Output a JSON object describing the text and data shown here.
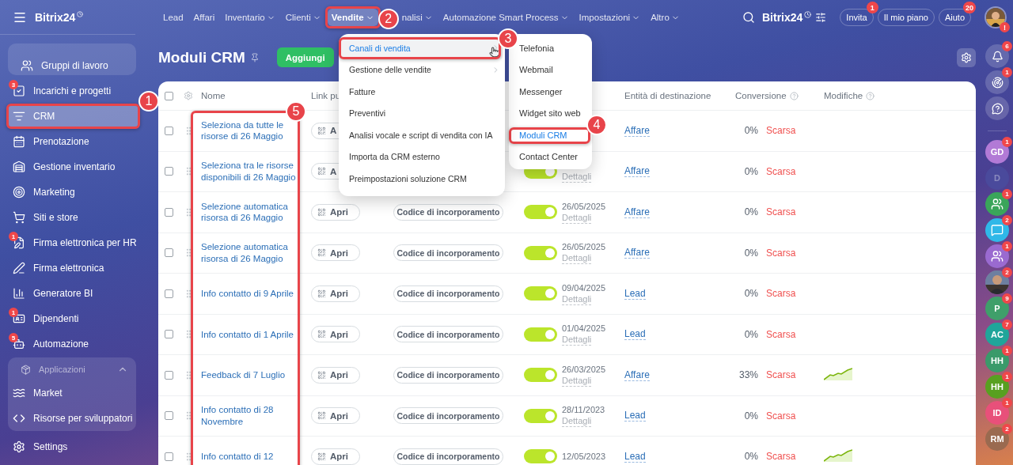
{
  "sidebar": {
    "logo": "Bitrix24",
    "items": [
      {
        "label": "Gruppi di lavoro",
        "selected": false,
        "grouped": true
      },
      {
        "label": "Incarichi e progetti",
        "badge": "3",
        "selected": false
      },
      {
        "label": "CRM",
        "selected": true,
        "callout": "1"
      },
      {
        "label": "Prenotazione",
        "selected": false
      },
      {
        "label": "Gestione inventario",
        "selected": false
      },
      {
        "label": "Marketing",
        "selected": false
      },
      {
        "label": "Siti e store",
        "selected": false
      },
      {
        "label": "Firma elettronica per HR",
        "badge": "1",
        "selected": false
      },
      {
        "label": "Firma elettronica",
        "selected": false
      },
      {
        "label": "Generatore BI",
        "selected": false
      },
      {
        "label": "Dipendenti",
        "badge": "1",
        "selected": false
      },
      {
        "label": "Automazione",
        "badge": "5",
        "selected": false
      }
    ],
    "apps": {
      "title": "Applicazioni",
      "expanded": true,
      "items": [
        {
          "label": "Market",
          "selected": false
        },
        {
          "label": "Risorse per sviluppatori",
          "selected": false
        }
      ]
    },
    "settings": "Settings"
  },
  "topbar": {
    "nav": [
      {
        "label": "Lead",
        "dropdown": false,
        "selected": false
      },
      {
        "label": "Affari",
        "dropdown": false,
        "selected": false
      },
      {
        "label": "Inventario",
        "dropdown": true,
        "selected": false
      },
      {
        "label": "Clienti",
        "dropdown": true,
        "selected": false
      },
      {
        "label": "Vendite",
        "dropdown": true,
        "selected": true,
        "callout": "2"
      },
      {
        "label": "nalisi",
        "dropdown": true,
        "selected": false
      },
      {
        "label": "Automazione Smart Process",
        "dropdown": true,
        "selected": false
      },
      {
        "label": "Impostazioni",
        "dropdown": true,
        "selected": false
      },
      {
        "label": "Altro",
        "dropdown": true,
        "selected": false
      }
    ],
    "brand": "Bitrix24",
    "buttons": [
      {
        "label": "Invita",
        "badge": "1"
      },
      {
        "label": "Il mio piano"
      },
      {
        "label": "Aiuto",
        "badge": "20"
      }
    ],
    "avatar_badge": "!"
  },
  "sales_menu": {
    "items": [
      {
        "label": "Canali di vendita",
        "submenu": true,
        "selected": true,
        "callout": "3"
      },
      {
        "label": "Gestione delle vendite",
        "submenu": true,
        "selected": false
      },
      {
        "label": "Fatture",
        "submenu": false,
        "selected": false
      },
      {
        "label": "Preventivi",
        "submenu": false,
        "selected": false
      },
      {
        "label": "Analisi vocale e script di vendita con IA",
        "submenu": false,
        "selected": false
      },
      {
        "label": "Importa da CRM esterno",
        "submenu": false,
        "selected": false
      },
      {
        "label": "Preimpostazioni soluzione CRM",
        "submenu": false,
        "selected": false
      }
    ]
  },
  "channels_menu": {
    "items": [
      {
        "label": "Telefonia",
        "selected": false
      },
      {
        "label": "Webmail",
        "selected": false
      },
      {
        "label": "Messenger",
        "selected": false
      },
      {
        "label": "Widget sito web",
        "selected": false
      },
      {
        "label": "Moduli CRM",
        "selected": true,
        "callout": "4"
      },
      {
        "label": "Contact Center",
        "selected": false
      }
    ]
  },
  "page": {
    "title": "Moduli CRM",
    "add_button": "Aggiungi"
  },
  "table": {
    "name_callout": "5",
    "all_checked": false,
    "columns": [
      {
        "label": "Nome",
        "help": false
      },
      {
        "label": "Link pu",
        "help": false
      },
      {
        "label": "Entità di destinazione",
        "help": false
      },
      {
        "label": "Conversione",
        "help": true
      },
      {
        "label": "Modifiche",
        "help": true
      }
    ],
    "rows": [
      {
        "checked": false,
        "name": "Seleziona da tutte le risorse di 26 Maggio",
        "link": "A",
        "entity": "Affare",
        "conversion": "0%",
        "rating": "Scarsa",
        "trend": false
      },
      {
        "checked": false,
        "name": "Seleziona tra le risorse disponibili di 26 Maggio",
        "link": "A",
        "active": true,
        "details": "Dettagli",
        "entity": "Affare",
        "conversion": "0%",
        "rating": "Scarsa",
        "trend": false
      },
      {
        "checked": false,
        "name": "Selezione automatica risorsa di 26 Maggio",
        "link": "Apri",
        "embed": "Codice di incorporamento",
        "active": true,
        "date": "26/05/2025",
        "details": "Dettagli",
        "entity": "Affare",
        "conversion": "0%",
        "rating": "Scarsa",
        "trend": false
      },
      {
        "checked": false,
        "name": "Selezione automatica risorsa di 26 Maggio",
        "link": "Apri",
        "embed": "Codice di incorporamento",
        "active": true,
        "date": "26/05/2025",
        "details": "Dettagli",
        "entity": "Affare",
        "conversion": "0%",
        "rating": "Scarsa",
        "trend": false
      },
      {
        "checked": false,
        "name": "Info contatto di 9 Aprile",
        "link": "Apri",
        "embed": "Codice di incorporamento",
        "active": true,
        "date": "09/04/2025",
        "details": "Dettagli",
        "entity": "Lead",
        "conversion": "0%",
        "rating": "Scarsa",
        "trend": false
      },
      {
        "checked": false,
        "name": "Info contatto di 1 Aprile",
        "link": "Apri",
        "embed": "Codice di incorporamento",
        "active": true,
        "date": "01/04/2025",
        "details": "Dettagli",
        "entity": "Lead",
        "conversion": "0%",
        "rating": "Scarsa",
        "trend": false
      },
      {
        "checked": false,
        "name": "Feedback di 7 Luglio",
        "link": "Apri",
        "embed": "Codice di incorporamento",
        "active": true,
        "date": "26/03/2025",
        "details": "Dettagli",
        "entity": "Affare",
        "conversion": "33%",
        "rating": "Scarsa",
        "trend": true
      },
      {
        "checked": false,
        "name": "Info contatto di 28 Novembre",
        "link": "Apri",
        "embed": "Codice di incorporamento",
        "active": true,
        "date": "28/11/2023",
        "details": "Dettagli",
        "entity": "Lead",
        "conversion": "0%",
        "rating": "Scarsa",
        "trend": false
      },
      {
        "checked": false,
        "name": "Info contatto di 12",
        "link": "Apri",
        "embed": "Codice di incorporamento",
        "active": true,
        "date": "12/05/2023",
        "entity": "Lead",
        "conversion": "0%",
        "rating": "Scarsa",
        "trend": true
      }
    ]
  },
  "rail": {
    "tools": [
      {
        "kind": "bell",
        "badge": "6"
      },
      {
        "kind": "target",
        "badge": "1"
      },
      {
        "kind": "support"
      }
    ],
    "contacts": [
      {
        "kind": "initials",
        "initials": "GD",
        "color": "#b27ad6",
        "badge": "1",
        "dimmed": false
      },
      {
        "kind": "initials",
        "initials": "D",
        "color": "#4a4a9c",
        "dimmed": true
      },
      {
        "kind": "group",
        "color": "#3aa55a",
        "badge": "1",
        "dimmed": false
      },
      {
        "kind": "chat",
        "color": "#2fb8e8",
        "badge": "2",
        "dimmed": false
      },
      {
        "kind": "group",
        "color": "#9a6ad0",
        "badge": "1",
        "dimmed": false
      },
      {
        "badge": "2",
        "dimmed": false
      },
      {
        "kind": "initials",
        "initials": "P",
        "color": "#3f9f6a",
        "badge": "9",
        "dimmed": false
      },
      {
        "kind": "initials",
        "initials": "AC",
        "color": "#1fa59a",
        "badge": "7",
        "dimmed": false
      },
      {
        "kind": "initials",
        "initials": "HH",
        "color": "#3a9a6a",
        "badge": "1",
        "dimmed": false
      },
      {
        "kind": "initials",
        "initials": "HH",
        "color": "#58a020",
        "badge": "1",
        "dimmed": false
      },
      {
        "kind": "initials",
        "initials": "ID",
        "color": "#e8507a",
        "badge": "1",
        "dimmed": false
      },
      {
        "kind": "initials",
        "initials": "RM",
        "color": "#9a6a50",
        "badge": "2",
        "dimmed": false
      }
    ]
  }
}
